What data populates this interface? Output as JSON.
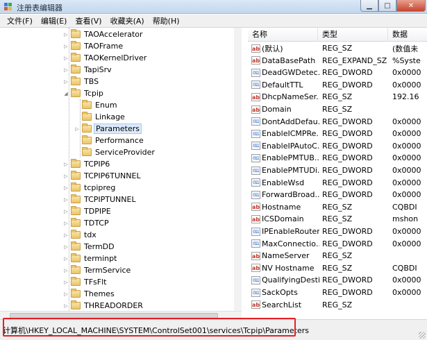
{
  "window": {
    "title": "注册表编辑器"
  },
  "menu": [
    "文件(F)",
    "编辑(E)",
    "查看(V)",
    "收藏夹(A)",
    "帮助(H)"
  ],
  "tree": [
    {
      "label": "TAOAccelerator",
      "level": 1,
      "expander": "collapsed",
      "selected": false
    },
    {
      "label": "TAOFrame",
      "level": 1,
      "expander": "collapsed",
      "selected": false
    },
    {
      "label": "TAOKernelDriver",
      "level": 1,
      "expander": "collapsed",
      "selected": false
    },
    {
      "label": "TapiSrv",
      "level": 1,
      "expander": "collapsed",
      "selected": false
    },
    {
      "label": "TBS",
      "level": 1,
      "expander": "collapsed",
      "selected": false
    },
    {
      "label": "Tcpip",
      "level": 1,
      "expander": "expanded",
      "selected": false
    },
    {
      "label": "Enum",
      "level": 2,
      "expander": "none",
      "selected": false
    },
    {
      "label": "Linkage",
      "level": 2,
      "expander": "none",
      "selected": false
    },
    {
      "label": "Parameters",
      "level": 2,
      "expander": "collapsed",
      "selected": true
    },
    {
      "label": "Performance",
      "level": 2,
      "expander": "none",
      "selected": false
    },
    {
      "label": "ServiceProvider",
      "level": 2,
      "expander": "none",
      "selected": false
    },
    {
      "label": "TCPIP6",
      "level": 1,
      "expander": "collapsed",
      "selected": false
    },
    {
      "label": "TCPIP6TUNNEL",
      "level": 1,
      "expander": "collapsed",
      "selected": false
    },
    {
      "label": "tcpipreg",
      "level": 1,
      "expander": "collapsed",
      "selected": false
    },
    {
      "label": "TCPIPTUNNEL",
      "level": 1,
      "expander": "collapsed",
      "selected": false
    },
    {
      "label": "TDPIPE",
      "level": 1,
      "expander": "collapsed",
      "selected": false
    },
    {
      "label": "TDTCP",
      "level": 1,
      "expander": "collapsed",
      "selected": false
    },
    {
      "label": "tdx",
      "level": 1,
      "expander": "collapsed",
      "selected": false
    },
    {
      "label": "TermDD",
      "level": 1,
      "expander": "collapsed",
      "selected": false
    },
    {
      "label": "terminpt",
      "level": 1,
      "expander": "collapsed",
      "selected": false
    },
    {
      "label": "TermService",
      "level": 1,
      "expander": "collapsed",
      "selected": false
    },
    {
      "label": "TFsFlt",
      "level": 1,
      "expander": "collapsed",
      "selected": false
    },
    {
      "label": "Themes",
      "level": 1,
      "expander": "collapsed",
      "selected": false
    },
    {
      "label": "THREADORDER",
      "level": 1,
      "expander": "collapsed",
      "selected": false
    }
  ],
  "columns": {
    "name": "名称",
    "type": "类型",
    "data": "数据"
  },
  "values": [
    {
      "name": "(默认)",
      "type": "REG_SZ",
      "data": "(数值未",
      "icon": "string-value-icon"
    },
    {
      "name": "DataBasePath",
      "type": "REG_EXPAND_SZ",
      "data": "%Syste",
      "icon": "string-value-icon"
    },
    {
      "name": "DeadGWDetec...",
      "type": "REG_DWORD",
      "data": "0x0000",
      "icon": "binary-value-icon"
    },
    {
      "name": "DefaultTTL",
      "type": "REG_DWORD",
      "data": "0x0000",
      "icon": "binary-value-icon"
    },
    {
      "name": "DhcpNameSer...",
      "type": "REG_SZ",
      "data": "192.16",
      "icon": "string-value-icon"
    },
    {
      "name": "Domain",
      "type": "REG_SZ",
      "data": "",
      "icon": "string-value-icon"
    },
    {
      "name": "DontAddDefau...",
      "type": "REG_DWORD",
      "data": "0x0000",
      "icon": "binary-value-icon"
    },
    {
      "name": "EnableICMPRe...",
      "type": "REG_DWORD",
      "data": "0x0000",
      "icon": "binary-value-icon"
    },
    {
      "name": "EnableIPAutoC...",
      "type": "REG_DWORD",
      "data": "0x0000",
      "icon": "binary-value-icon"
    },
    {
      "name": "EnablePMTUB...",
      "type": "REG_DWORD",
      "data": "0x0000",
      "icon": "binary-value-icon"
    },
    {
      "name": "EnablePMTUDi...",
      "type": "REG_DWORD",
      "data": "0x0000",
      "icon": "binary-value-icon"
    },
    {
      "name": "EnableWsd",
      "type": "REG_DWORD",
      "data": "0x0000",
      "icon": "binary-value-icon"
    },
    {
      "name": "ForwardBroad...",
      "type": "REG_DWORD",
      "data": "0x0000",
      "icon": "binary-value-icon"
    },
    {
      "name": "Hostname",
      "type": "REG_SZ",
      "data": "CQBDI",
      "icon": "string-value-icon"
    },
    {
      "name": "ICSDomain",
      "type": "REG_SZ",
      "data": "mshon",
      "icon": "string-value-icon"
    },
    {
      "name": "IPEnableRouter",
      "type": "REG_DWORD",
      "data": "0x0000",
      "icon": "binary-value-icon"
    },
    {
      "name": "MaxConnectio...",
      "type": "REG_DWORD",
      "data": "0x0000",
      "icon": "binary-value-icon"
    },
    {
      "name": "NameServer",
      "type": "REG_SZ",
      "data": "",
      "icon": "string-value-icon"
    },
    {
      "name": "NV Hostname",
      "type": "REG_SZ",
      "data": "CQBDI",
      "icon": "string-value-icon"
    },
    {
      "name": "QualifyingDesti...",
      "type": "REG_DWORD",
      "data": "0x0000",
      "icon": "binary-value-icon"
    },
    {
      "name": "SackOpts",
      "type": "REG_DWORD",
      "data": "0x0000",
      "icon": "binary-value-icon"
    },
    {
      "name": "SearchList",
      "type": "REG_SZ",
      "data": "",
      "icon": "string-value-icon"
    }
  ],
  "status": {
    "path": "计算机\\HKEY_LOCAL_MACHINE\\SYSTEM\\ControlSet001\\services\\Tcpip\\Parameters"
  },
  "colors": {
    "highlight": "#e21f26",
    "selection": "#dcebfc"
  }
}
